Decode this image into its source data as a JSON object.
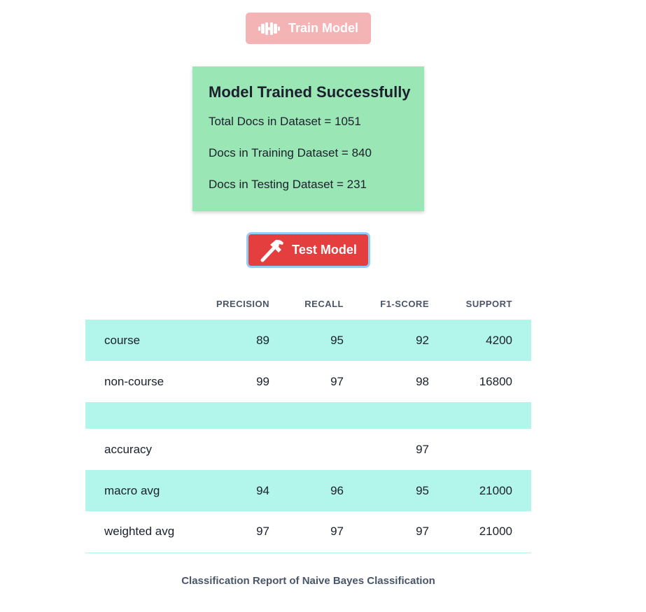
{
  "train_button": {
    "label": "Train Model",
    "icon": "dumbbell-icon",
    "color": "#f4b4b6"
  },
  "result": {
    "title": "Model Trained Successfully",
    "lines": [
      "Total Docs in Dataset = 1051",
      "Docs in Training Dataset = 840",
      "Docs in Testing Dataset = 231"
    ],
    "color": "#9ae6b4"
  },
  "test_button": {
    "label": "Test Model",
    "icon": "hammer-icon",
    "color": "#e53e3e"
  },
  "report": {
    "headers": [
      "",
      "PRECISION",
      "RECALL",
      "F1-SCORE",
      "SUPPORT"
    ],
    "rows": [
      {
        "label": "course",
        "precision": "89",
        "recall": "95",
        "f1": "92",
        "support": "4200"
      },
      {
        "label": "non-course",
        "precision": "99",
        "recall": "97",
        "f1": "98",
        "support": "16800"
      },
      {
        "label": "",
        "precision": "",
        "recall": "",
        "f1": "",
        "support": ""
      },
      {
        "label": "accuracy",
        "precision": "",
        "recall": "",
        "f1": "97",
        "support": ""
      },
      {
        "label": "macro avg",
        "precision": "94",
        "recall": "96",
        "f1": "95",
        "support": "21000"
      },
      {
        "label": "weighted avg",
        "precision": "97",
        "recall": "97",
        "f1": "97",
        "support": "21000"
      }
    ],
    "stripe_color": "#b2f5ea",
    "caption": "Classification Report of Naive Bayes Classification"
  }
}
